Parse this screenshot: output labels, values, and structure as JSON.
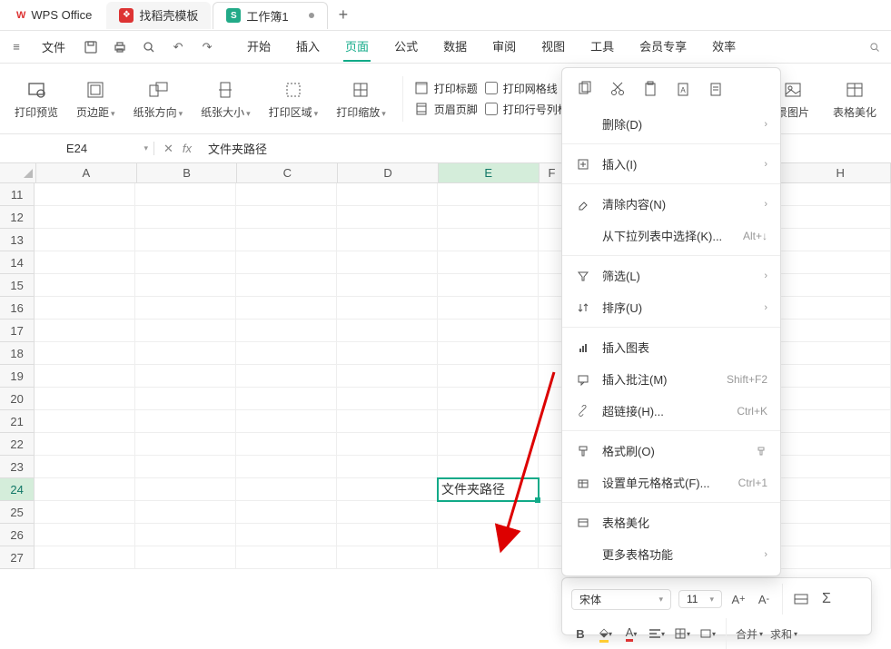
{
  "titlebar": {
    "app_name": "WPS Office",
    "template_tab": "找稻壳模板",
    "doc_tab": "工作簿1",
    "add": "+"
  },
  "menubar": {
    "file": "文件",
    "items": [
      "开始",
      "插入",
      "页面",
      "公式",
      "数据",
      "审阅",
      "视图",
      "工具",
      "会员专享",
      "效率"
    ],
    "active_index": 2
  },
  "ribbon": {
    "print_preview": "打印预览",
    "margins": "页边距",
    "orientation": "纸张方向",
    "size": "纸张大小",
    "print_area": "打印区域",
    "print_scale": "打印缩放",
    "print_titles": "打印标题",
    "header_footer": "页眉页脚",
    "gridlines": "打印网格线",
    "rowcol_headings": "打印行号列标",
    "bg_image": "景图片",
    "table_beautify": "表格美化"
  },
  "formula_bar": {
    "namebox": "E24",
    "fx": "fx",
    "content": "文件夹路径"
  },
  "grid": {
    "columns": [
      "A",
      "B",
      "C",
      "D",
      "E",
      "F",
      "H"
    ],
    "rows": [
      11,
      12,
      13,
      14,
      15,
      16,
      17,
      18,
      19,
      20,
      21,
      22,
      23,
      24,
      25,
      26,
      27
    ],
    "active_cell": {
      "row": 24,
      "col": "E",
      "value": "文件夹路径"
    }
  },
  "contextmenu": {
    "delete": "删除(D)",
    "insert": "插入(I)",
    "clear": "清除内容(N)",
    "dropdown_select": "从下拉列表中选择(K)...",
    "dropdown_shortcut": "Alt+↓",
    "filter": "筛选(L)",
    "sort": "排序(U)",
    "insert_chart": "插入图表",
    "insert_comment": "插入批注(M)",
    "comment_shortcut": "Shift+F2",
    "hyperlink": "超链接(H)...",
    "hyperlink_shortcut": "Ctrl+K",
    "format_painter": "格式刷(O)",
    "cell_format": "设置单元格格式(F)...",
    "cell_format_shortcut": "Ctrl+1",
    "table_beautify": "表格美化",
    "more_table": "更多表格功能"
  },
  "minitoolbar": {
    "font": "宋体",
    "size": "11",
    "bold": "B",
    "merge": "合并",
    "sum": "求和"
  }
}
